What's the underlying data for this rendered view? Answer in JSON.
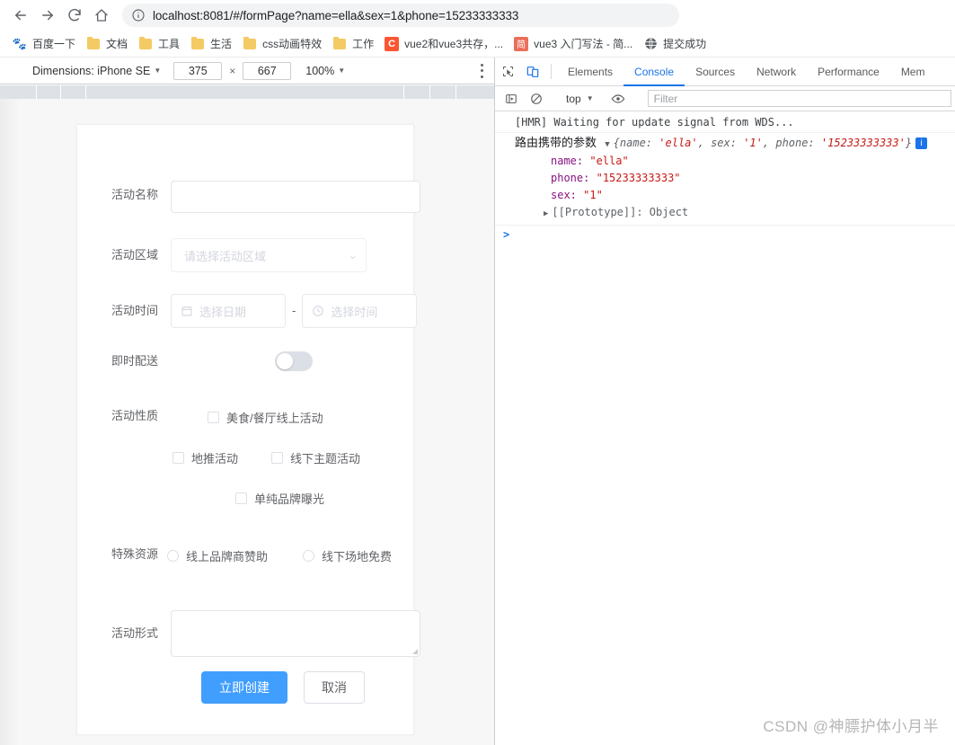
{
  "browser": {
    "nav": {
      "back": "back-arrow",
      "forward": "forward-arrow",
      "reload": "reload",
      "home": "home"
    },
    "omnibox": {
      "info_icon": "info-circle-icon",
      "url": "localhost:8081/#/formPage?name=ella&sex=1&phone=15233333333"
    },
    "bookmarks": [
      {
        "label": "百度一下",
        "icon": "baidu-paw-icon",
        "type": "site",
        "color": "#2b5fd9"
      },
      {
        "label": "文档",
        "icon": "folder-icon",
        "type": "folder"
      },
      {
        "label": "工具",
        "icon": "folder-icon",
        "type": "folder"
      },
      {
        "label": "生活",
        "icon": "folder-icon",
        "type": "folder"
      },
      {
        "label": "css动画特效",
        "icon": "folder-icon",
        "type": "folder"
      },
      {
        "label": "工作",
        "icon": "folder-icon",
        "type": "folder"
      },
      {
        "label": "vue2和vue3共存，...",
        "icon": "csdn-icon",
        "type": "site",
        "color": "#fc5531",
        "glyph": "C"
      },
      {
        "label": "vue3 入门写法 - 简...",
        "icon": "jianshu-icon",
        "type": "site",
        "color": "#ea6f5a",
        "glyph": "简"
      },
      {
        "label": "提交成功",
        "icon": "globe-icon",
        "type": "site",
        "color": "#5f6368",
        "glyph": ""
      }
    ]
  },
  "device_toolbar": {
    "dimensions_label": "Dimensions: iPhone SE",
    "width": "375",
    "height": "667",
    "times": "×",
    "zoom": "100%",
    "more_icon": "kebab-menu-icon"
  },
  "form": {
    "rows": [
      {
        "label": "活动名称",
        "type": "input",
        "value": "",
        "placeholder": ""
      },
      {
        "label": "活动区域",
        "type": "select",
        "placeholder": "请选择活动区域"
      },
      {
        "label": "活动时间",
        "type": "daterange",
        "date_placeholder": "选择日期",
        "time_placeholder": "选择时间",
        "separator": "-"
      },
      {
        "label": "即时配送",
        "type": "switch",
        "on": false
      },
      {
        "label": "活动性质",
        "type": "checkbox-group"
      },
      {
        "label": "特殊资源",
        "type": "radio-group"
      },
      {
        "label": "活动形式",
        "type": "textarea",
        "value": ""
      }
    ],
    "checkboxes": [
      {
        "label": "美食/餐厅线上活动",
        "checked": false
      },
      {
        "label": "地推活动",
        "checked": false
      },
      {
        "label": "线下主题活动",
        "checked": false
      },
      {
        "label": "单纯品牌曝光",
        "checked": false
      }
    ],
    "radios": [
      {
        "label": "线上品牌商赞助",
        "checked": false
      },
      {
        "label": "线下场地免费",
        "checked": false
      }
    ],
    "buttons": {
      "submit": "立即创建",
      "cancel": "取消"
    }
  },
  "devtools": {
    "inspect_icon": "inspect-cursor-icon",
    "device_toggle_icon": "device-toolbar-icon",
    "tabs": [
      {
        "label": "Elements",
        "active": false
      },
      {
        "label": "Console",
        "active": true
      },
      {
        "label": "Sources",
        "active": false
      },
      {
        "label": "Network",
        "active": false
      },
      {
        "label": "Performance",
        "active": false
      },
      {
        "label": "Mem",
        "active": false
      }
    ],
    "console_toolbar": {
      "sidebar_icon": "console-sidebar-icon",
      "clear_icon": "clear-console-icon",
      "context": "top",
      "eye_icon": "live-expression-icon",
      "filter_placeholder": "Filter"
    },
    "console_messages": {
      "hmr": "[HMR] Waiting for update signal from WDS...",
      "log_label": "路由携带的参数",
      "object_preview": "{name: 'ella', sex: '1', phone: '15233333333'}",
      "preview_parts": {
        "open": "{",
        "k1": "name:",
        "v1": "'ella'",
        "k2": "sex:",
        "v2": "'1'",
        "k3": "phone:",
        "v3": "'15233333333'",
        "close": "}"
      },
      "props": [
        {
          "key": "name:",
          "value": "\"ella\""
        },
        {
          "key": "phone:",
          "value": "\"15233333333\""
        },
        {
          "key": "sex:",
          "value": "\"1\""
        }
      ],
      "prototype": "[[Prototype]]: Object",
      "info_badge": "i"
    }
  },
  "watermark": "CSDN @神膘护体小月半",
  "colors": {
    "accent": "#409eff",
    "devtools_accent": "#1a73e8",
    "page_bg": "#f7f7f7",
    "card_bg": "#ffffff"
  }
}
